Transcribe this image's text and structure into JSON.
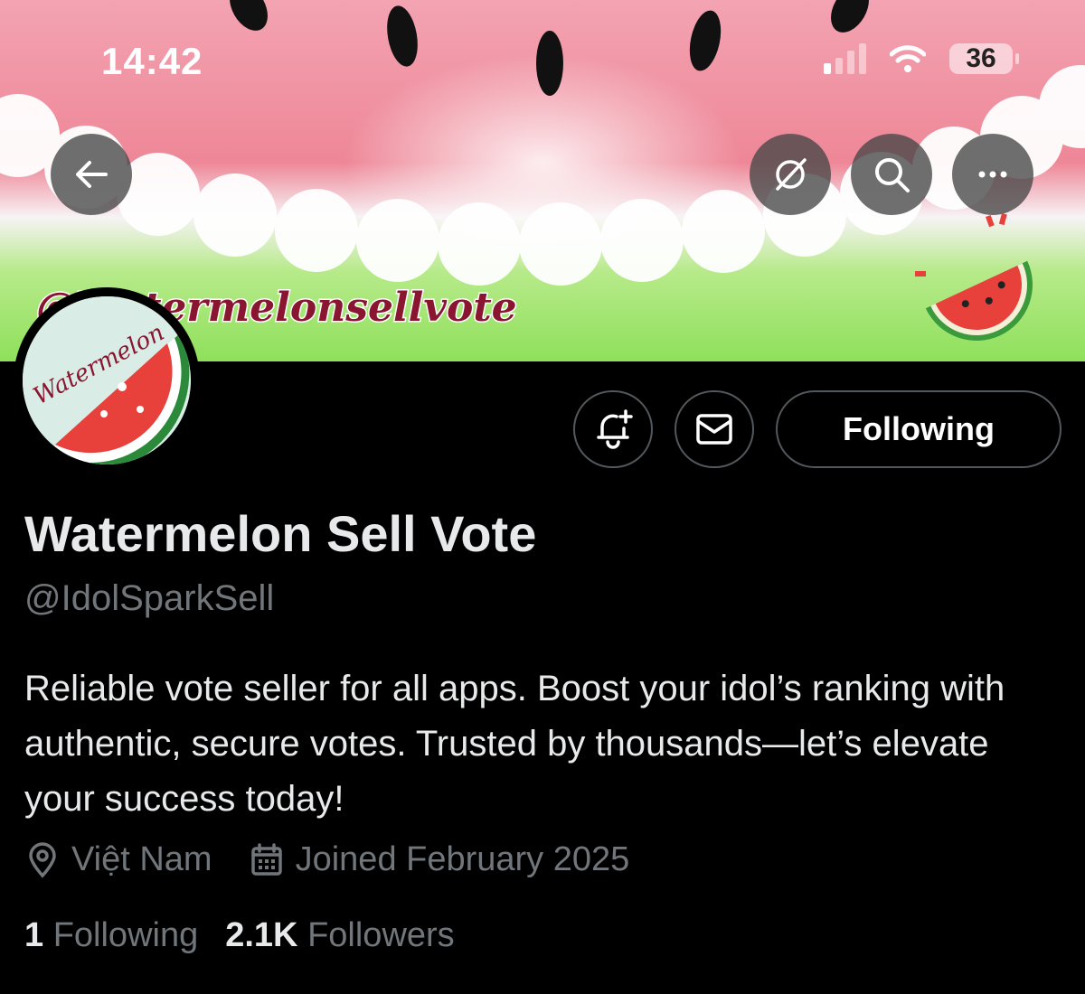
{
  "status_bar": {
    "time": "14:42",
    "battery": "36"
  },
  "banner": {
    "overlay_text": "@Watermelonsellvote"
  },
  "avatar": {
    "text": "Watermelon"
  },
  "header_icons": [
    "back-arrow-icon",
    "grok-icon",
    "search-icon",
    "more-icon"
  ],
  "actions": {
    "notify_icon": "bell-plus-icon",
    "message_icon": "mail-icon",
    "follow_label": "Following"
  },
  "profile": {
    "name": "Watermelon Sell Vote",
    "handle": "@IdolSparkSell",
    "bio": "Reliable vote seller for all apps. Boost your idol’s ranking with authentic, secure votes. Trusted by thousands—let’s elevate your success today!",
    "location": "Việt Nam",
    "joined": "Joined February 2025"
  },
  "stats": {
    "following_count": "1",
    "following_label": "Following",
    "followers_count": "2.1K",
    "followers_label": "Followers"
  },
  "colors": {
    "background": "#000000",
    "text": "#e7e9ea",
    "muted": "#71767b",
    "border": "#53585c"
  }
}
